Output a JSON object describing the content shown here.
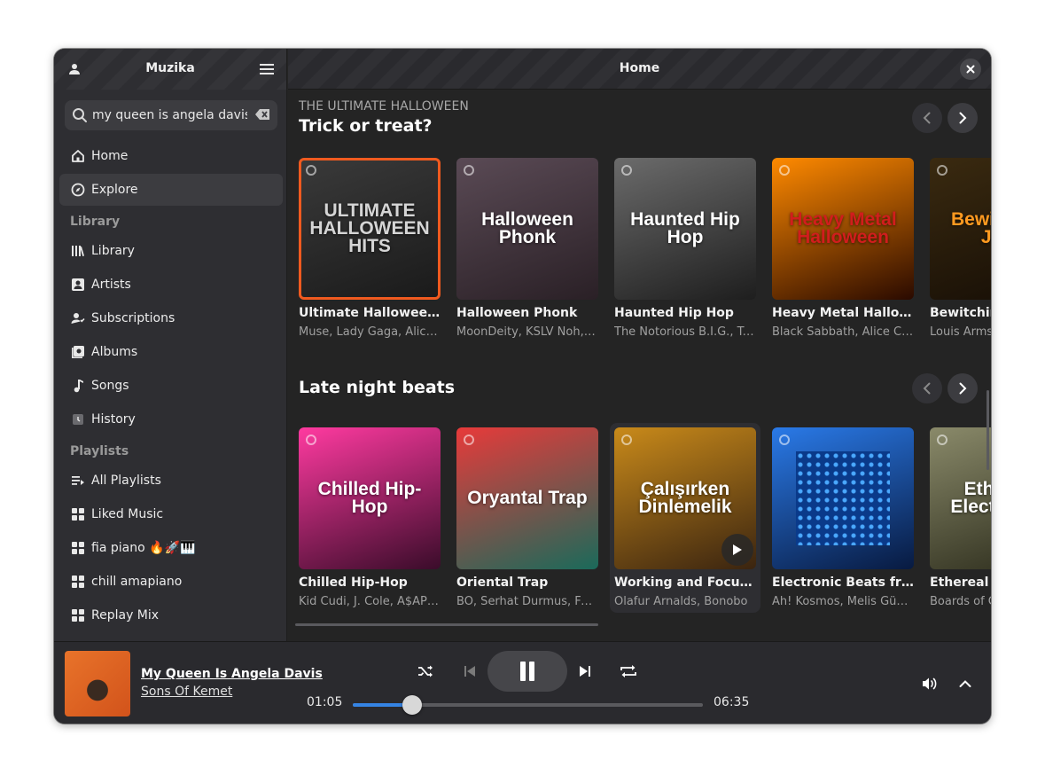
{
  "sidebar": {
    "title": "Muzika",
    "search": {
      "value": "my queen is angela davis",
      "placeholder": ""
    },
    "nav": [
      {
        "label": "Home",
        "icon": "home-icon"
      },
      {
        "label": "Explore",
        "icon": "compass-icon",
        "active": true
      }
    ],
    "library_label": "Library",
    "library": [
      {
        "label": "Library",
        "icon": "library-icon"
      },
      {
        "label": "Artists",
        "icon": "artist-icon"
      },
      {
        "label": "Subscriptions",
        "icon": "subscriptions-icon"
      },
      {
        "label": "Albums",
        "icon": "album-icon"
      },
      {
        "label": "Songs",
        "icon": "music-note-icon"
      },
      {
        "label": "History",
        "icon": "history-icon"
      }
    ],
    "playlists_label": "Playlists",
    "playlists": [
      {
        "label": "All Playlists",
        "icon": "playlist-icon"
      },
      {
        "label": "Liked Music",
        "icon": "grid-icon"
      },
      {
        "label": "fia piano 🔥🚀🎹",
        "icon": "grid-icon"
      },
      {
        "label": "chill amapiano",
        "icon": "grid-icon"
      },
      {
        "label": "Replay Mix",
        "icon": "grid-icon"
      }
    ]
  },
  "main": {
    "title": "Home",
    "shelves": [
      {
        "eyebrow": "THE ULTIMATE HALLOWEEN",
        "title": "Trick or treat?",
        "cards": [
          {
            "cover_text": "ULTIMATE HALLOWEEN HITS",
            "title": "Ultimate Halloween Hits",
            "subtitle": "Muse, Lady Gaga, Alice Cooper",
            "colors": [
              "#3a3a3a",
              "#1a1a1a"
            ],
            "accent": "#d5d5d5"
          },
          {
            "cover_text": "Halloween Phonk",
            "title": "Halloween Phonk",
            "subtitle": "MoonDeity, KSLV Noh, Kordhell",
            "colors": [
              "#5a4a55",
              "#2a2026"
            ],
            "accent": "#ffffff"
          },
          {
            "cover_text": "Haunted Hip Hop",
            "title": "Haunted Hip Hop",
            "subtitle": "The Notorious B.I.G., Tupac",
            "colors": [
              "#6b6b6b",
              "#1e1e1e"
            ],
            "accent": "#ffffff"
          },
          {
            "cover_text": "Heavy Metal Halloween",
            "title": "Heavy Metal Halloween",
            "subtitle": "Black Sabbath, Alice Cooper",
            "colors": [
              "#ff8a00",
              "#2a0a00"
            ],
            "accent": "#d11d1d"
          },
          {
            "cover_text": "Bewitching Jazz",
            "title": "Bewitching Jazz",
            "subtitle": "Louis Armstrong",
            "colors": [
              "#3a2a10",
              "#150d05"
            ],
            "accent": "#ff9a20"
          }
        ]
      },
      {
        "eyebrow": "",
        "title": "Late night beats",
        "cards": [
          {
            "cover_text": "Chilled Hip-Hop",
            "title": "Chilled Hip-Hop",
            "subtitle": "Kid Cudi, J. Cole, A$AP Rocky",
            "colors": [
              "#ff3aa0",
              "#3a0c2a"
            ],
            "accent": "#ffffff"
          },
          {
            "cover_text": "Oryantal Trap",
            "title": "Oriental Trap",
            "subtitle": "BÖ, Serhat Durmus, Fury",
            "colors": [
              "#e83a3a",
              "#1a6a5a"
            ],
            "accent": "#ffffff"
          },
          {
            "cover_text": "Çalışırken Dinlemelik",
            "title": "Working and Focusing",
            "subtitle": "Ólafur Arnalds, Bonobo",
            "colors": [
              "#c98a1a",
              "#3a2410"
            ],
            "accent": "#ffffff",
            "hover": true
          },
          {
            "cover_text": "",
            "title": "Electronic Beats from Turkey",
            "subtitle": "Ah! Kosmos, Melis Güven",
            "colors": [
              "#2a7ae8",
              "#081a40"
            ],
            "accent": "#ffffff"
          },
          {
            "cover_text": "Ethereal Electronica",
            "title": "Ethereal Electronica",
            "subtitle": "Boards of Canada",
            "colors": [
              "#8a8a6a",
              "#2a2a1a"
            ],
            "accent": "#ffffff"
          }
        ]
      }
    ]
  },
  "player": {
    "song": "My Queen Is Angela Davis",
    "artist": "Sons Of Kemet",
    "elapsed": "01:05",
    "duration": "06:35",
    "progress": 0.17,
    "accent": "#3584e4"
  }
}
